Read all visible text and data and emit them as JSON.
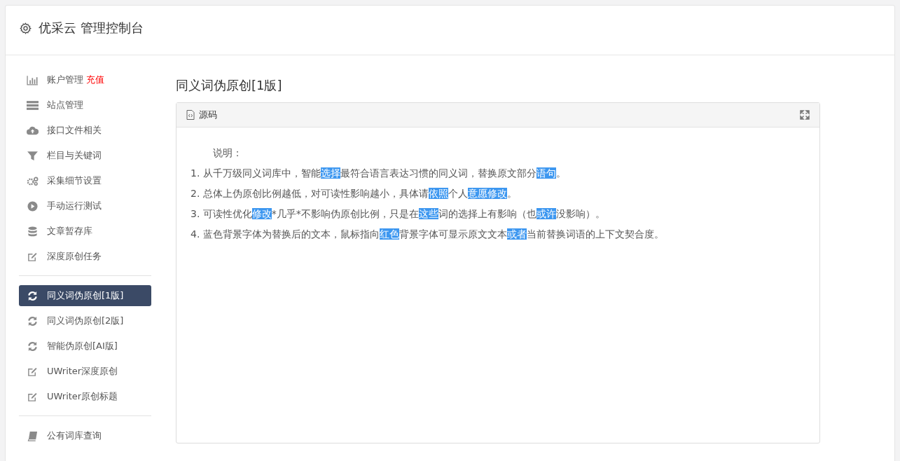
{
  "header": {
    "title": "优采云 管理控制台"
  },
  "sidebar": {
    "groups": [
      {
        "items": [
          {
            "kind": "chart",
            "label": "账户管理",
            "badge": "充值",
            "selected": false
          },
          {
            "kind": "server",
            "label": "站点管理",
            "selected": false
          },
          {
            "kind": "cloud",
            "label": "接口文件相关",
            "selected": false
          },
          {
            "kind": "filter",
            "label": "栏目与关键词",
            "selected": false
          },
          {
            "kind": "gears",
            "label": "采集细节设置",
            "selected": false
          },
          {
            "kind": "play",
            "label": "手动运行测试",
            "selected": false
          },
          {
            "kind": "database",
            "label": "文章暂存库",
            "selected": false
          },
          {
            "kind": "edit",
            "label": "深度原创任务",
            "selected": false
          }
        ]
      },
      {
        "items": [
          {
            "kind": "refresh",
            "label": "同义词伪原创[1版]",
            "selected": true
          },
          {
            "kind": "refresh",
            "label": "同义词伪原创[2版]",
            "selected": false
          },
          {
            "kind": "refresh",
            "label": "智能伪原创[AI版]",
            "selected": false
          },
          {
            "kind": "edit",
            "label": "UWriter深度原创",
            "selected": false
          },
          {
            "kind": "edit",
            "label": "UWriter原创标题",
            "selected": false
          }
        ]
      },
      {
        "items": [
          {
            "kind": "book",
            "label": "公有词库查询",
            "selected": false
          }
        ]
      }
    ]
  },
  "main": {
    "title": "同义词伪原创[1版]",
    "panel": {
      "title": "源码",
      "heading": "说明：",
      "lines": [
        [
          {
            "text": "1. 从千万级同义词库中，智能",
            "highlighted": false
          },
          {
            "text": "选择",
            "highlighted": true
          },
          {
            "text": "最符合语言表达习惯的同义词，替换原文部分",
            "highlighted": false
          },
          {
            "text": "语句",
            "highlighted": true
          },
          {
            "text": "。",
            "highlighted": false
          }
        ],
        [
          {
            "text": "2. 总体上伪原创比例越低，对可读性影响越小，具体请",
            "highlighted": false
          },
          {
            "text": "依照",
            "highlighted": true
          },
          {
            "text": "个人",
            "highlighted": false
          },
          {
            "text": "意愿",
            "highlighted": true
          },
          {
            "text": "修改",
            "highlighted": true
          },
          {
            "text": "。",
            "highlighted": false
          }
        ],
        [
          {
            "text": "3. 可读性优化",
            "highlighted": false
          },
          {
            "text": "修改",
            "highlighted": true
          },
          {
            "text": "*几乎*不影响伪原创比例，只是在",
            "highlighted": false
          },
          {
            "text": "这些",
            "highlighted": true
          },
          {
            "text": "词的选择上有影响（也",
            "highlighted": false
          },
          {
            "text": "或许",
            "highlighted": true
          },
          {
            "text": "没影响）。",
            "highlighted": false
          }
        ],
        [
          {
            "text": "4. 蓝色背景字体为替换后的文本，鼠标指向",
            "highlighted": false
          },
          {
            "text": "红色",
            "highlighted": true
          },
          {
            "text": "背景字体可显示原文文本",
            "highlighted": false
          },
          {
            "text": "或者",
            "highlighted": true
          },
          {
            "text": "当前替换词语的上下文契合度。",
            "highlighted": false
          }
        ]
      ]
    }
  }
}
